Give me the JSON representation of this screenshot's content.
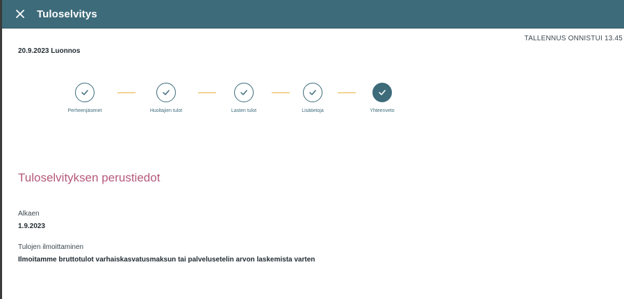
{
  "header": {
    "title": "Tuloselvitys",
    "close_icon": "close-icon",
    "background": "#3d6b7a"
  },
  "status": {
    "save_text": "TALLENNUS ONNISTUI 13.45",
    "draft_label": "20.9.2023 Luonnos"
  },
  "stepper": {
    "accent_color": "#e8b23a",
    "steps": [
      {
        "label": "Perheenjäsenet",
        "state": "done"
      },
      {
        "label": "Huoltajien tulot",
        "state": "done"
      },
      {
        "label": "Lasten tulot",
        "state": "done"
      },
      {
        "label": "Lisätietoja",
        "state": "done"
      },
      {
        "label": "Yhteenveto",
        "state": "active"
      }
    ]
  },
  "section": {
    "title": "Tuloselvityksen perustiedot",
    "title_color": "#b5587a",
    "fields": [
      {
        "label": "Alkaen",
        "value": "1.9.2023"
      },
      {
        "label": "Tulojen ilmoittaminen",
        "value": "Ilmoitamme bruttotulot varhaiskasvatusmaksun tai palvelusetelin arvon laskemista varten"
      }
    ]
  }
}
